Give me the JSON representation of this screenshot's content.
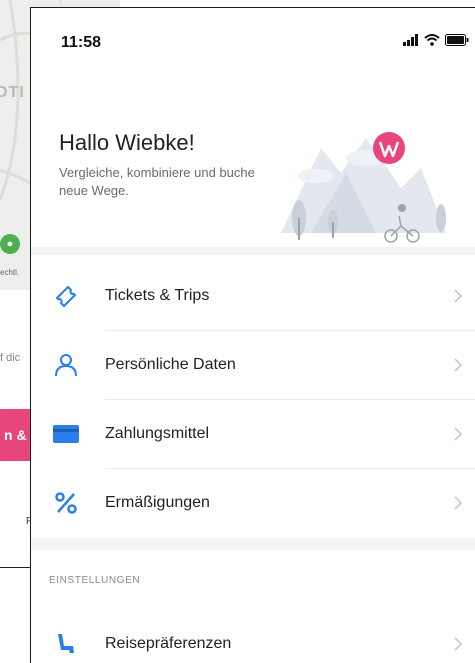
{
  "background_screen": {
    "map_label": "DTI",
    "attribution": "echtl.",
    "hint_text": "f dic",
    "action_button_label": "n & F",
    "tab_letter": "P"
  },
  "status_bar": {
    "time": "11:58"
  },
  "profile": {
    "greeting": "Hallo Wiebke!",
    "subtitle": "Vergleiche, kombiniere und buche neue Wege."
  },
  "menu": {
    "items": [
      {
        "label": "Tickets & Trips",
        "icon": "ticket-icon"
      },
      {
        "label": "Persönliche Daten",
        "icon": "person-icon"
      },
      {
        "label": "Zahlungsmittel",
        "icon": "card-icon"
      },
      {
        "label": "Ermäßigungen",
        "icon": "percent-icon"
      }
    ]
  },
  "settings": {
    "section_title": "EINSTELLUNGEN",
    "items": [
      {
        "label": "Reisepräferenzen",
        "icon": "seat-icon"
      }
    ]
  },
  "colors": {
    "accent_blue": "#2b7de9",
    "brand_pink": "#e8457a"
  }
}
